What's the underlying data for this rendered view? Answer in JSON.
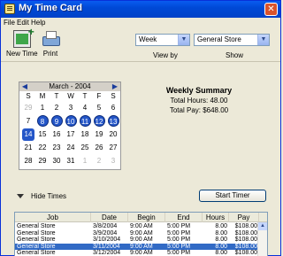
{
  "window": {
    "title": "My Time Card",
    "close_glyph": "✕"
  },
  "menu": {
    "file": "File",
    "edit": "Edit",
    "help": "Help"
  },
  "toolbar": {
    "new_time": "New Time",
    "print": "Print"
  },
  "filters": {
    "period_value": "Week",
    "period_caption": "View by",
    "show_value": "General Store",
    "show_caption": "Show"
  },
  "calendar": {
    "month_label": "March - 2004",
    "prev_glyph": "◀",
    "next_glyph": "▶",
    "dow": [
      "S",
      "M",
      "T",
      "W",
      "T",
      "F",
      "S"
    ],
    "weeks": [
      [
        {
          "d": "29",
          "s": "muted"
        },
        {
          "d": "1",
          "s": ""
        },
        {
          "d": "2",
          "s": ""
        },
        {
          "d": "3",
          "s": ""
        },
        {
          "d": "4",
          "s": ""
        },
        {
          "d": "5",
          "s": ""
        },
        {
          "d": "6",
          "s": ""
        }
      ],
      [
        {
          "d": "7",
          "s": ""
        },
        {
          "d": "8",
          "s": "sel"
        },
        {
          "d": "9",
          "s": "sel"
        },
        {
          "d": "10",
          "s": "sel"
        },
        {
          "d": "11",
          "s": "sel"
        },
        {
          "d": "12",
          "s": "sel"
        },
        {
          "d": "13",
          "s": "sel"
        }
      ],
      [
        {
          "d": "14",
          "s": "cur"
        },
        {
          "d": "15",
          "s": ""
        },
        {
          "d": "16",
          "s": ""
        },
        {
          "d": "17",
          "s": ""
        },
        {
          "d": "18",
          "s": ""
        },
        {
          "d": "19",
          "s": ""
        },
        {
          "d": "20",
          "s": ""
        }
      ],
      [
        {
          "d": "21",
          "s": ""
        },
        {
          "d": "22",
          "s": ""
        },
        {
          "d": "23",
          "s": ""
        },
        {
          "d": "24",
          "s": ""
        },
        {
          "d": "25",
          "s": ""
        },
        {
          "d": "26",
          "s": ""
        },
        {
          "d": "27",
          "s": ""
        }
      ],
      [
        {
          "d": "28",
          "s": ""
        },
        {
          "d": "29",
          "s": ""
        },
        {
          "d": "30",
          "s": ""
        },
        {
          "d": "31",
          "s": ""
        },
        {
          "d": "1",
          "s": "muted"
        },
        {
          "d": "2",
          "s": "muted"
        },
        {
          "d": "3",
          "s": "muted"
        }
      ]
    ]
  },
  "summary": {
    "title": "Weekly Summary",
    "total_hours": "Total Hours: 48.00",
    "total_pay": "Total Pay: $648.00"
  },
  "controls": {
    "hide_times": "Hide Times",
    "start_timer": "Start Timer"
  },
  "table": {
    "columns": [
      "Job",
      "Date",
      "Begin",
      "End",
      "Hours",
      "Pay"
    ],
    "rows": [
      [
        "General Store",
        "3/8/2004",
        "9:00 AM",
        "5:00 PM",
        "8.00",
        "$108.00"
      ],
      [
        "General Store",
        "3/9/2004",
        "9:00 AM",
        "5:00 PM",
        "8.00",
        "$108.00"
      ],
      [
        "General Store",
        "3/10/2004",
        "9:00 AM",
        "5:00 PM",
        "8.00",
        "$108.00"
      ],
      [
        "General Store",
        "3/11/2004",
        "9:00 AM",
        "5:00 PM",
        "8.00",
        "$108.00"
      ],
      [
        "General Store",
        "3/12/2004",
        "9:00 AM",
        "5:00 PM",
        "8.00",
        "$108.00"
      ]
    ],
    "selected_row": 3
  },
  "colors": {
    "titlebar": "#0049D6",
    "selection": "#316AC5",
    "calendar_highlight": "#2456C8"
  }
}
